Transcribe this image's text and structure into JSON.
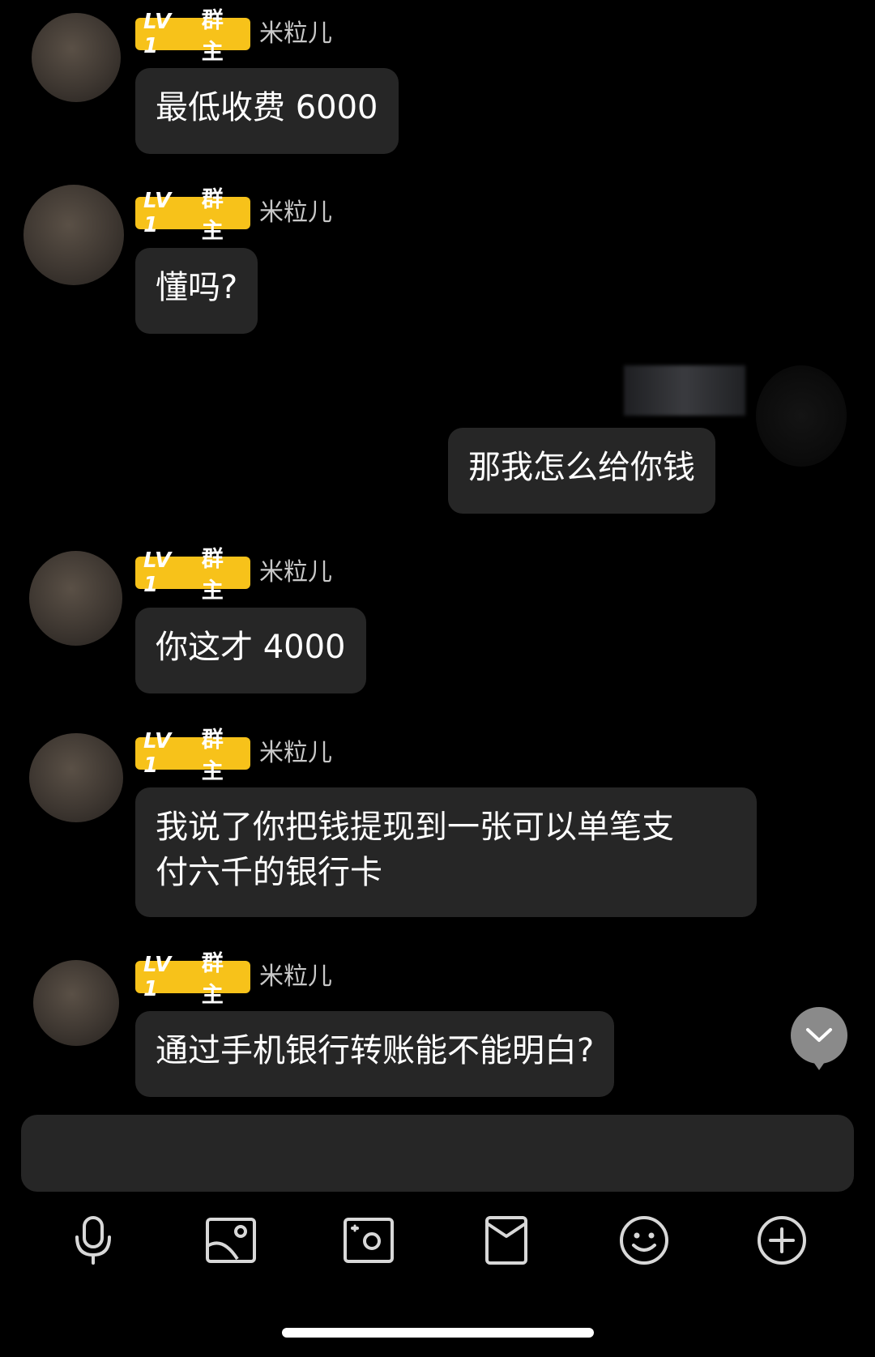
{
  "messages": [
    {
      "badge_lv": "LV 1",
      "badge_role": "群主",
      "name": "米粒儿",
      "text": "最低收费 6000"
    },
    {
      "badge_lv": "LV 1",
      "badge_role": "群主",
      "name": "米粒儿",
      "text": "懂吗?"
    },
    {
      "text": "那我怎么给你钱"
    },
    {
      "badge_lv": "LV 1",
      "badge_role": "群主",
      "name": "米粒儿",
      "text": "你这才 4000"
    },
    {
      "badge_lv": "LV 1",
      "badge_role": "群主",
      "name": "米粒儿",
      "text_line1": "我说了你把钱提现到一张可以单笔支",
      "text_line2": "付六千的银行卡"
    },
    {
      "badge_lv": "LV 1",
      "badge_role": "群主",
      "name": "米粒儿",
      "text": "通过手机银行转账能不能明白?"
    }
  ],
  "toolbar_icons": [
    "microphone-icon",
    "image-icon",
    "camera-icon",
    "red-packet-icon",
    "emoji-icon",
    "plus-icon"
  ],
  "colors": {
    "badge": "#f7c21a",
    "bubble": "#262626",
    "background": "#000000"
  }
}
